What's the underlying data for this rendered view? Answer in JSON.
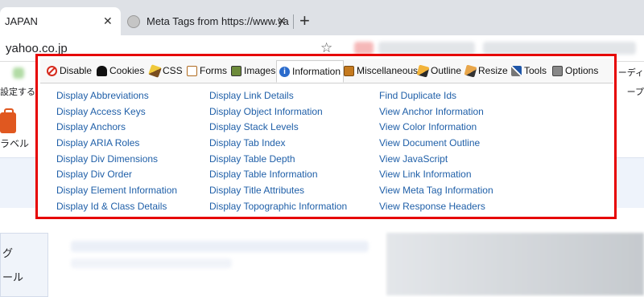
{
  "browser": {
    "active_tab_title": "JAPAN",
    "second_tab_title": "Meta Tags from https://www.ya",
    "url": "yahoo.co.jp"
  },
  "background_page": {
    "left_snippet": "設定する",
    "right_snippet": "ープ",
    "right_top_snippet": "ーディ",
    "label_under_icon": "ラベル",
    "sidebar_items": [
      "グ",
      "ール"
    ]
  },
  "toolbar": {
    "tabs": [
      {
        "label": "Disable",
        "icon": "disable-icon"
      },
      {
        "label": "Cookies",
        "icon": "cookies-icon"
      },
      {
        "label": "CSS",
        "icon": "css-icon"
      },
      {
        "label": "Forms",
        "icon": "forms-icon"
      },
      {
        "label": "Images",
        "icon": "images-icon"
      },
      {
        "label": "Information",
        "icon": "information-icon",
        "active": true
      },
      {
        "label": "Miscellaneous",
        "icon": "miscellaneous-icon"
      },
      {
        "label": "Outline",
        "icon": "outline-icon"
      },
      {
        "label": "Resize",
        "icon": "resize-icon"
      },
      {
        "label": "Tools",
        "icon": "tools-icon"
      },
      {
        "label": "Options",
        "icon": "options-icon"
      }
    ]
  },
  "information_menu": {
    "column1": [
      "Display Abbreviations",
      "Display Access Keys",
      "Display Anchors",
      "Display ARIA Roles",
      "Display Div Dimensions",
      "Display Div Order",
      "Display Element Information",
      "Display Id & Class Details"
    ],
    "column2": [
      "Display Link Details",
      "Display Object Information",
      "Display Stack Levels",
      "Display Tab Index",
      "Display Table Depth",
      "Display Table Information",
      "Display Title Attributes",
      "Display Topographic Information"
    ],
    "column3": [
      "Find Duplicate Ids",
      "View Anchor Information",
      "View Color Information",
      "View Document Outline",
      "View JavaScript",
      "View Link Information",
      "View Meta Tag Information",
      "View Response Headers"
    ]
  },
  "colors": {
    "highlight_border": "#e60000",
    "link": "#1f5fa8"
  }
}
